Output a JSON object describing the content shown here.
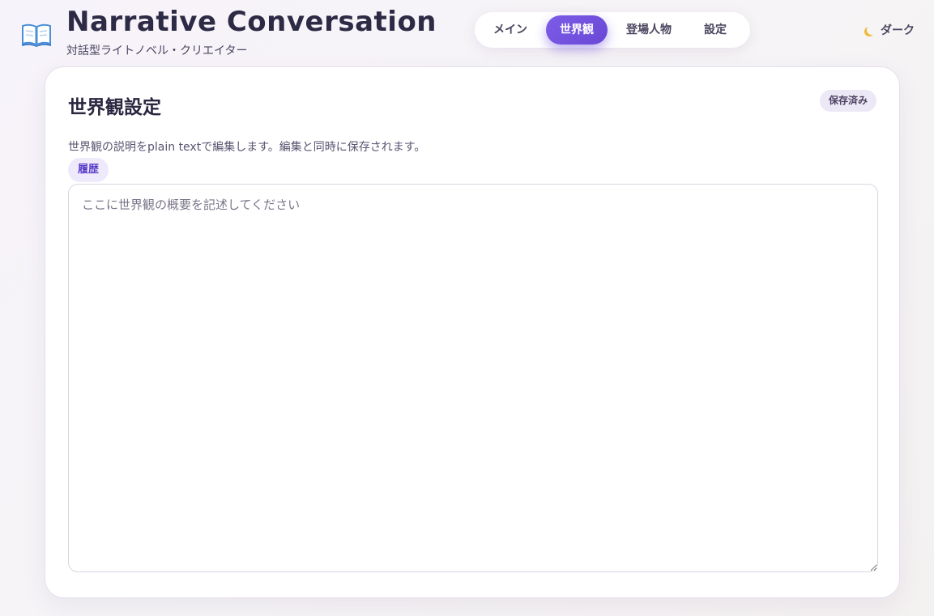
{
  "header": {
    "icon": "open-book-icon",
    "title": "Narrative Conversation",
    "subtitle": "対話型ライトノベル・クリエイター"
  },
  "tabs": [
    {
      "label": "メイン",
      "active": false
    },
    {
      "label": "世界観",
      "active": true
    },
    {
      "label": "登場人物",
      "active": false
    },
    {
      "label": "設定",
      "active": false
    }
  ],
  "theme_toggle": {
    "icon": "moon-icon",
    "label": "ダーク"
  },
  "panel": {
    "title": "世界観設定",
    "status_badge": "保存済み",
    "description": "世界観の説明をplain textで編集します。編集と同時に保存されます。",
    "history_button": "履歴",
    "editor": {
      "value": "",
      "placeholder": "ここに世界観の概要を記述してください"
    }
  },
  "colors": {
    "accent": "#6f4fdc",
    "accent_soft": "#eee9fb",
    "text_primary": "#2b2640",
    "badge_bg": "#ece8f5"
  }
}
